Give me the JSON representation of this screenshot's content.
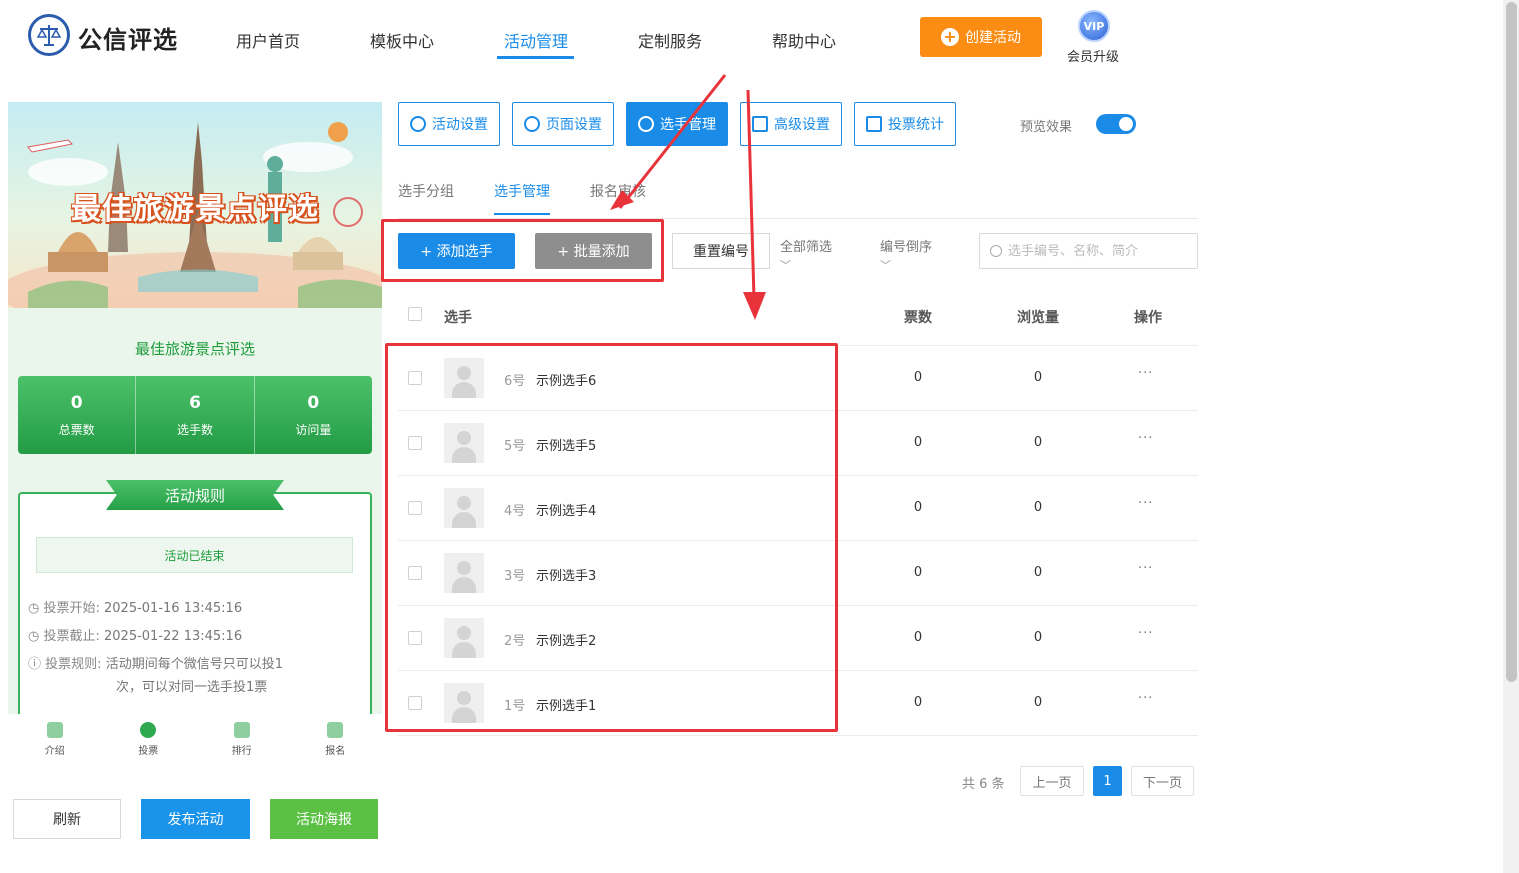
{
  "header": {
    "brand": "公信评选",
    "nav": [
      "用户首页",
      "模板中心",
      "活动管理",
      "定制服务",
      "帮助中心"
    ],
    "active_nav": "活动管理",
    "create_button": "创建活动",
    "vip_badge": "VIP",
    "vip_label": "会员升级"
  },
  "preview": {
    "banner_title": "最佳旅游景点评选",
    "title": "最佳旅游景点评选",
    "stats": [
      {
        "value": "0",
        "label": "总票数"
      },
      {
        "value": "6",
        "label": "选手数"
      },
      {
        "value": "0",
        "label": "访问量"
      }
    ],
    "rules_heading": "活动规则",
    "status": "活动已结束",
    "vote_start_label": "投票开始:",
    "vote_start": "2025-01-16 13:45:16",
    "vote_end_label": "投票截止:",
    "vote_end": "2025-01-22 13:45:16",
    "rule_label": "投票规则:",
    "rule_text_1": "活动期间每个微信号只可以投1",
    "rule_text_2": "次，可以对同一选手投1票",
    "tabs": [
      "介绍",
      "投票",
      "排行",
      "报名"
    ]
  },
  "actions": {
    "refresh": "刷新",
    "publish": "发布活动",
    "poster": "活动海报"
  },
  "toolbar": {
    "buttons": [
      "活动设置",
      "页面设置",
      "选手管理",
      "高级设置",
      "投票统计"
    ],
    "active": "选手管理",
    "preview_label": "预览效果",
    "preview_on": true
  },
  "subtabs": [
    "选手分组",
    "选手管理",
    "报名审核"
  ],
  "active_subtab": "选手管理",
  "controls": {
    "add": "+ 添加选手",
    "batch_add": "+ 批量添加",
    "reset_numbers": "重置编号",
    "filter_all": "全部筛选",
    "sort": "编号倒序",
    "search_placeholder": "选手编号、名称、简介"
  },
  "table": {
    "headers": {
      "player": "选手",
      "votes": "票数",
      "views": "浏览量",
      "ops": "操作"
    },
    "rows": [
      {
        "num": "6号",
        "name": "示例选手6",
        "votes": "0",
        "views": "0",
        "more": "···"
      },
      {
        "num": "5号",
        "name": "示例选手5",
        "votes": "0",
        "views": "0",
        "more": "···"
      },
      {
        "num": "4号",
        "name": "示例选手4",
        "votes": "0",
        "views": "0",
        "more": "···"
      },
      {
        "num": "3号",
        "name": "示例选手3",
        "votes": "0",
        "views": "0",
        "more": "···"
      },
      {
        "num": "2号",
        "name": "示例选手2",
        "votes": "0",
        "views": "0",
        "more": "···"
      },
      {
        "num": "1号",
        "name": "示例选手1",
        "votes": "0",
        "views": "0",
        "more": "···"
      }
    ]
  },
  "pagination": {
    "total": "共 6 条",
    "prev": "上一页",
    "current": "1",
    "next": "下一页"
  },
  "colors": {
    "primary": "#1a8ce8",
    "orange": "#fb8c14",
    "green": "#1d9c3a",
    "annotation_red": "#e8333a"
  }
}
